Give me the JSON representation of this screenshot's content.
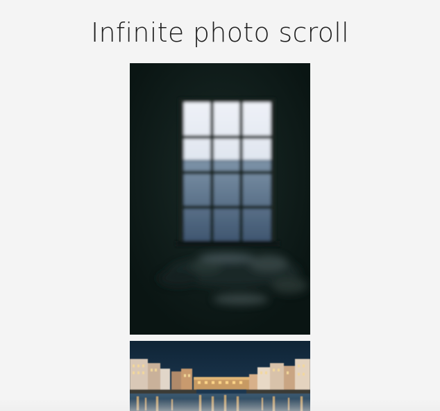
{
  "page": {
    "title": "Infinite photo scroll"
  },
  "photos": [
    {
      "subject": "window-at-night"
    },
    {
      "subject": "city-river-night"
    }
  ]
}
